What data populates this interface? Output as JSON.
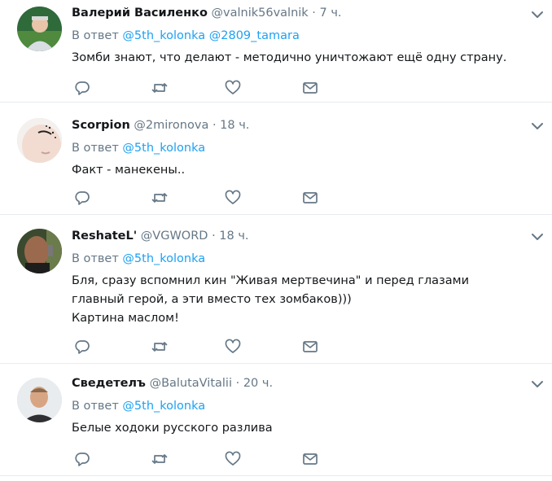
{
  "reply_prefix": "В ответ",
  "tweets": [
    {
      "name": "Валерий Василенко",
      "handle": "@valnik56valnik",
      "separator": "·",
      "time": "7 ч.",
      "mentions": [
        "@5th_kolonka",
        "@2809_tamara"
      ],
      "lines": [
        "Зомби знают, что делают - методично уничтожают ещё одну страну."
      ]
    },
    {
      "name": "Scorpion",
      "handle": "@2mironova",
      "separator": "·",
      "time": "18 ч.",
      "mentions": [
        "@5th_kolonka"
      ],
      "lines": [
        "Факт - манекены.."
      ]
    },
    {
      "name": "ReshateL'",
      "handle": "@VGWORD",
      "separator": "·",
      "time": "18 ч.",
      "mentions": [
        "@5th_kolonka"
      ],
      "lines": [
        "Бля, сразу вспомнил кин \"Живая мертвечина\" и перед глазами",
        "главный герой, а эти вместо тех зомбаков)))",
        "Картина маслом!"
      ]
    },
    {
      "name": "Сведетелъ",
      "handle": "@BalutaVitalii",
      "separator": "·",
      "time": "20 ч.",
      "mentions": [
        "@5th_kolonka"
      ],
      "lines": [
        "Белые ходоки русского разлива"
      ]
    }
  ],
  "icons": {
    "reply": "reply-icon",
    "retweet": "retweet-icon",
    "like": "heart-icon",
    "dm": "envelope-icon",
    "menu": "chevron-down-icon"
  },
  "colors": {
    "link": "#1da1f2",
    "secondary_text": "#657786",
    "icon": "#657786",
    "divider": "#e6ecf0"
  }
}
